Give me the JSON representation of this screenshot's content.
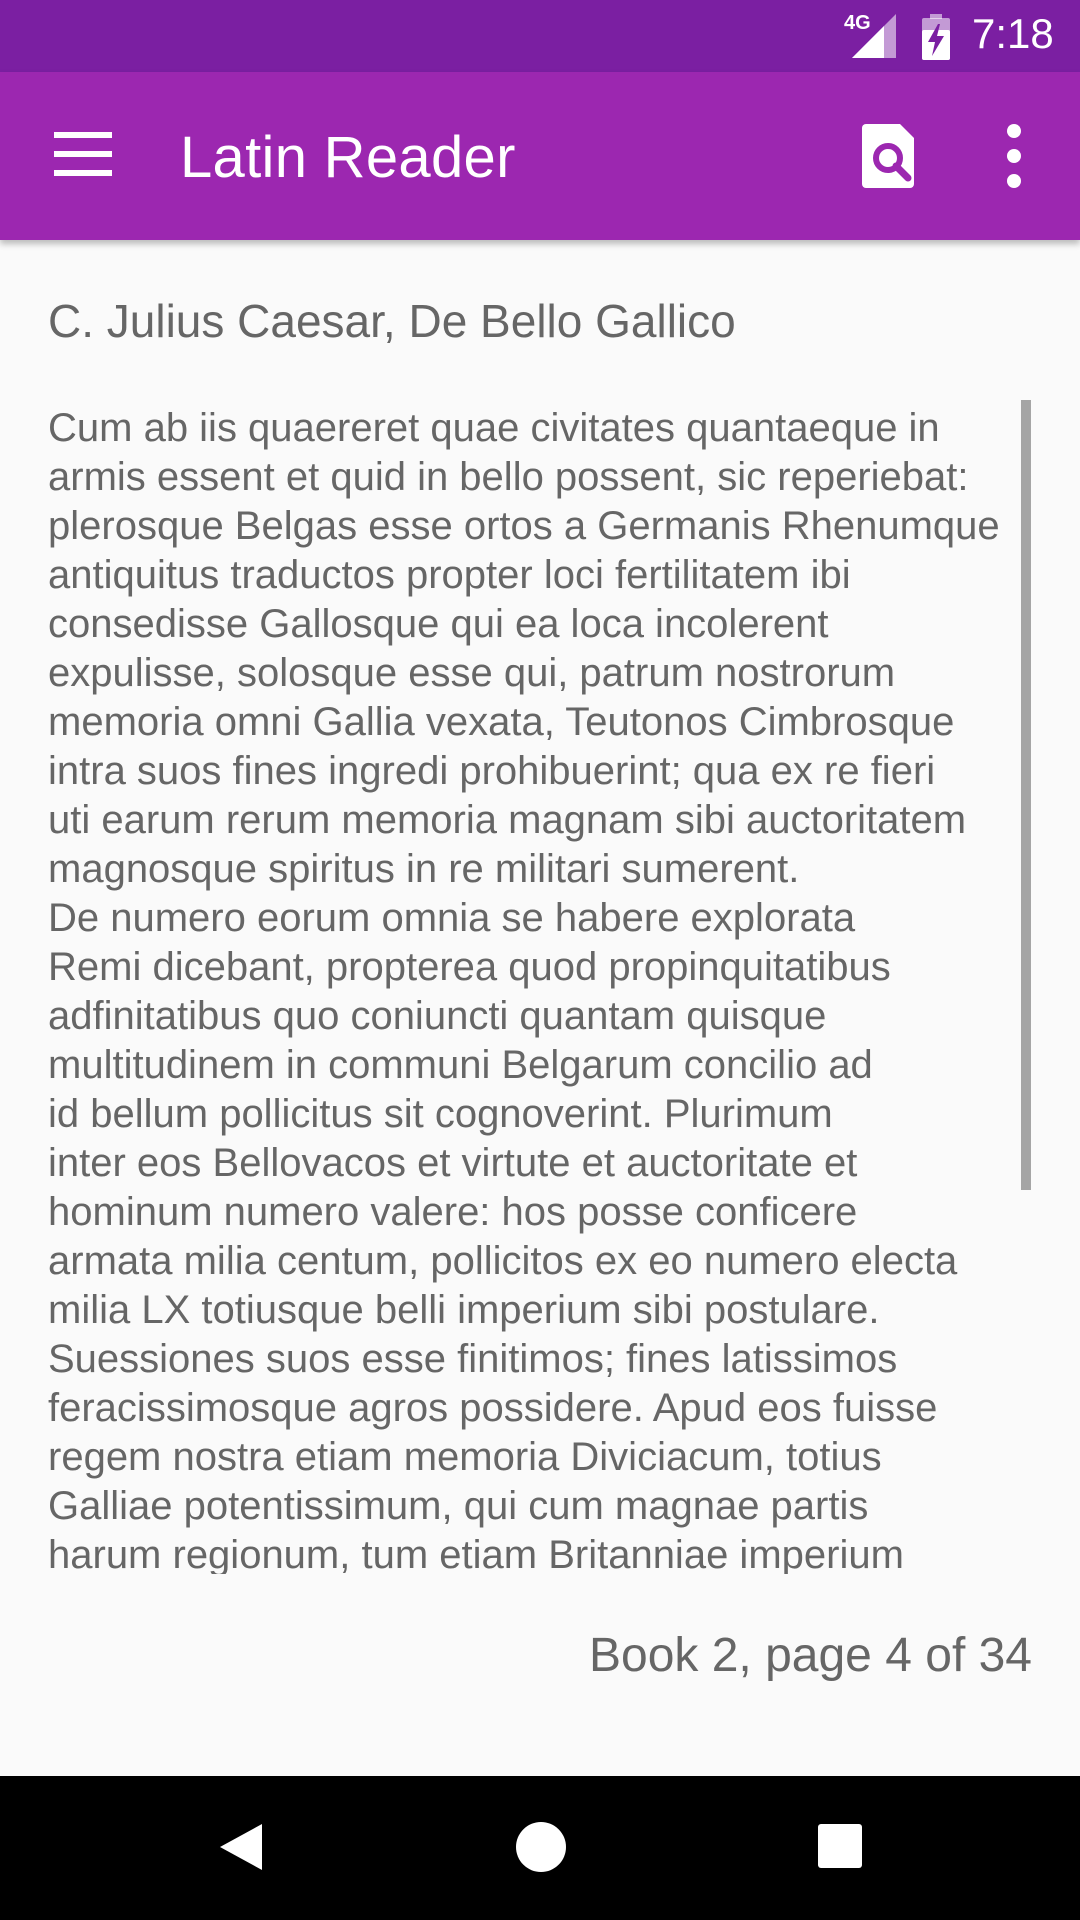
{
  "status_bar": {
    "network": "4G",
    "time": "7:18",
    "icons": [
      "signal-icon",
      "battery-charging-icon"
    ]
  },
  "app_bar": {
    "title": "Latin Reader",
    "icons": [
      "menu-icon",
      "search-document-icon",
      "more-vert-icon"
    ],
    "color": "#9c27b0",
    "status_color": "#7b1fa2"
  },
  "reader": {
    "book_title": "C. Julius Caesar, De Bello Gallico",
    "text": "Cum ab iis quaereret quae civitates quantaeque in\narmis essent et quid in bello possent, sic reperiebat:\nplerosque Belgas esse ortos a Germanis Rhenumque\nantiquitus traductos propter loci fertilitatem ibi\nconsedisse Gallosque qui ea loca incolerent\nexpulisse, solosque esse qui, patrum nostrorum\nmemoria omni Gallia vexata, Teutonos Cimbrosque\nintra suos fines ingredi prohibuerint; qua ex re fieri\nuti earum rerum memoria magnam sibi auctoritatem\nmagnosque spiritus in re militari sumerent.\nDe numero eorum omnia se habere explorata\nRemi dicebant, propterea quod propinquitatibus\nadfinitatibus quo coniuncti quantam quisque\nmultitudinem in communi Belgarum concilio ad\nid bellum pollicitus sit cognoverint. Plurimum\ninter eos Bellovacos et virtute et auctoritate et\nhominum numero valere: hos posse conficere\narmata milia centum, pollicitos ex eo numero electa\nmilia LX totiusque belli imperium sibi postulare.\nSuessiones suos esse finitimos; fines latissimos\nferacissimosque agros possidere. Apud eos fuisse\nregem nostra etiam memoria Diviciacum, totius\nGalliae potentissimum, qui cum magnae partis\nharum regionum, tum etiam Britanniae imperium",
    "page_indicator": "Book 2, page 4 of 34"
  },
  "nav_bar": {
    "icons": [
      "back-icon",
      "home-icon",
      "recents-icon"
    ]
  }
}
